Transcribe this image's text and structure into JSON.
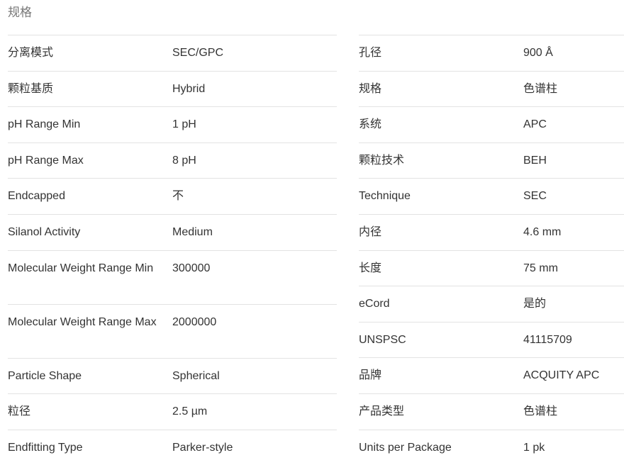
{
  "title": "规格",
  "left_specs": [
    {
      "label": "分离模式",
      "value": "SEC/GPC"
    },
    {
      "label": "颗粒基质",
      "value": "Hybrid"
    },
    {
      "label": "pH Range Min",
      "value": "1 pH"
    },
    {
      "label": "pH Range Max",
      "value": "8 pH"
    },
    {
      "label": "Endcapped",
      "value": "不"
    },
    {
      "label": "Silanol Activity",
      "value": "Medium"
    },
    {
      "label": "Molecular Weight Range Min",
      "value": "300000"
    },
    {
      "label": "Molecular Weight Range Max",
      "value": "2000000"
    },
    {
      "label": "Particle Shape",
      "value": "Spherical"
    },
    {
      "label": "粒径",
      "value": "2.5 µm"
    },
    {
      "label": "Endfitting Type",
      "value": "Parker-style"
    }
  ],
  "right_specs": [
    {
      "label": "孔径",
      "value": "900 Å"
    },
    {
      "label": "规格",
      "value": "色谱柱"
    },
    {
      "label": "系统",
      "value": "APC"
    },
    {
      "label": "颗粒技术",
      "value": "BEH"
    },
    {
      "label": "Technique",
      "value": "SEC"
    },
    {
      "label": "内径",
      "value": "4.6 mm"
    },
    {
      "label": "长度",
      "value": "75 mm"
    },
    {
      "label": "eCord",
      "value": "是的"
    },
    {
      "label": "UNSPSC",
      "value": "41115709"
    },
    {
      "label": "品牌",
      "value": "ACQUITY APC"
    },
    {
      "label": "产品类型",
      "value": "色谱柱"
    },
    {
      "label": "Units per Package",
      "value": "1 pk"
    }
  ]
}
